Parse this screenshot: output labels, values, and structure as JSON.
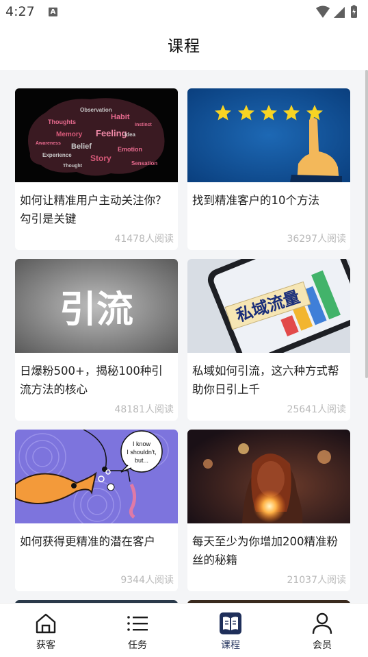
{
  "status": {
    "time": "4:27",
    "notification_badge": "A"
  },
  "header": {
    "title": "课程"
  },
  "courses": [
    {
      "title": "如何让精准用户主动关注你？勾引是关键",
      "views": "41478人阅读",
      "image": "brain-word-cloud"
    },
    {
      "title": "找到精准客户的10个方法",
      "views": "36297人阅读",
      "image": "five-stars-hand"
    },
    {
      "title": "日爆粉500+，揭秘100种引流方法的核心",
      "views": "48181人阅读",
      "image": "yinliu-text"
    },
    {
      "title": "私域如何引流，这六种方式帮助你日引上千",
      "views": "25641人阅读",
      "image": "private-traffic-phone"
    },
    {
      "title": "如何获得更精准的潜在客户",
      "views": "9344人阅读",
      "image": "fish-hook-worm"
    },
    {
      "title": "每天至少为你增加200精准粉丝的秘籍",
      "views": "21037人阅读",
      "image": "woman-lights"
    }
  ],
  "thumb_text": {
    "yinliu": "引流",
    "siyu": "私域流量",
    "bubble_line1": "I know",
    "bubble_line2": "I shouldn't,",
    "bubble_line3": "but..."
  },
  "bottom_nav": [
    {
      "label": "获客",
      "icon": "home-icon",
      "active": false
    },
    {
      "label": "任务",
      "icon": "list-icon",
      "active": false
    },
    {
      "label": "课程",
      "icon": "book-icon",
      "active": true
    },
    {
      "label": "会员",
      "icon": "person-icon",
      "active": false
    }
  ],
  "colors": {
    "background": "#f4f5f7",
    "nav_active": "#1f2f5a",
    "views_text": "#b9b9b9"
  }
}
